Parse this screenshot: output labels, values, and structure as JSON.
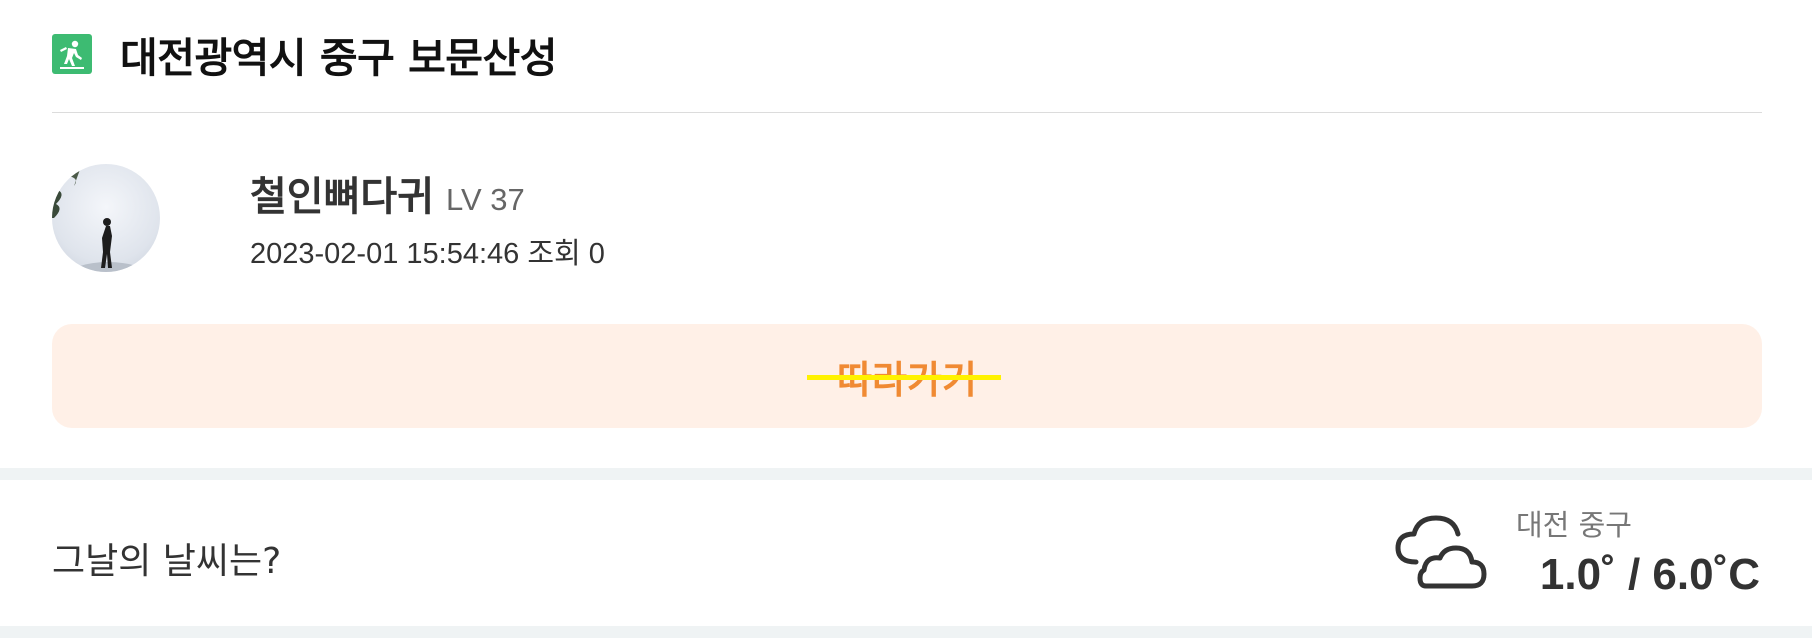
{
  "header": {
    "title": "대전광역시 중구 보문산성",
    "icon": "mountain-climbing-icon",
    "icon_color": "#3dbb72"
  },
  "author": {
    "name": "철인뼈다귀",
    "level": "LV 37",
    "datetime": "2023-02-01 15:54:46",
    "views_label": "조회",
    "views": "0"
  },
  "follow": {
    "label": "따라가기",
    "bg_color": "#fff0e7",
    "text_color": "#f08a33",
    "strike_color": "#fff200"
  },
  "weather": {
    "question": "그날의 날씨는?",
    "icon": "cloud-icon",
    "location": "대전 중구",
    "temperature": "1.0˚ / 6.0˚C"
  }
}
